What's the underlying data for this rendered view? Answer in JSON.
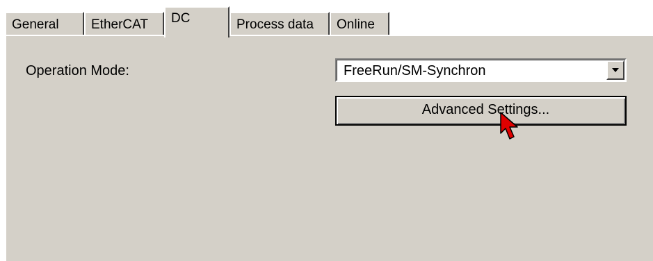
{
  "tabs": [
    {
      "label": "General",
      "selected": false
    },
    {
      "label": "EtherCAT",
      "selected": false
    },
    {
      "label": "DC",
      "selected": true
    },
    {
      "label": "Process data",
      "selected": false
    },
    {
      "label": "Online",
      "selected": false
    }
  ],
  "dc": {
    "operation_mode_label": "Operation Mode:",
    "operation_mode_value": "FreeRun/SM-Synchron",
    "advanced_button_label": "Advanced Settings..."
  },
  "colors": {
    "face": "#d4d0c8",
    "highlight": "#ffffff",
    "shadow": "#808080",
    "dark_shadow": "#404040",
    "cursor": "#e00000"
  },
  "icons": {
    "dropdown": "chevron-down-icon",
    "cursor": "mouse-pointer-icon"
  }
}
